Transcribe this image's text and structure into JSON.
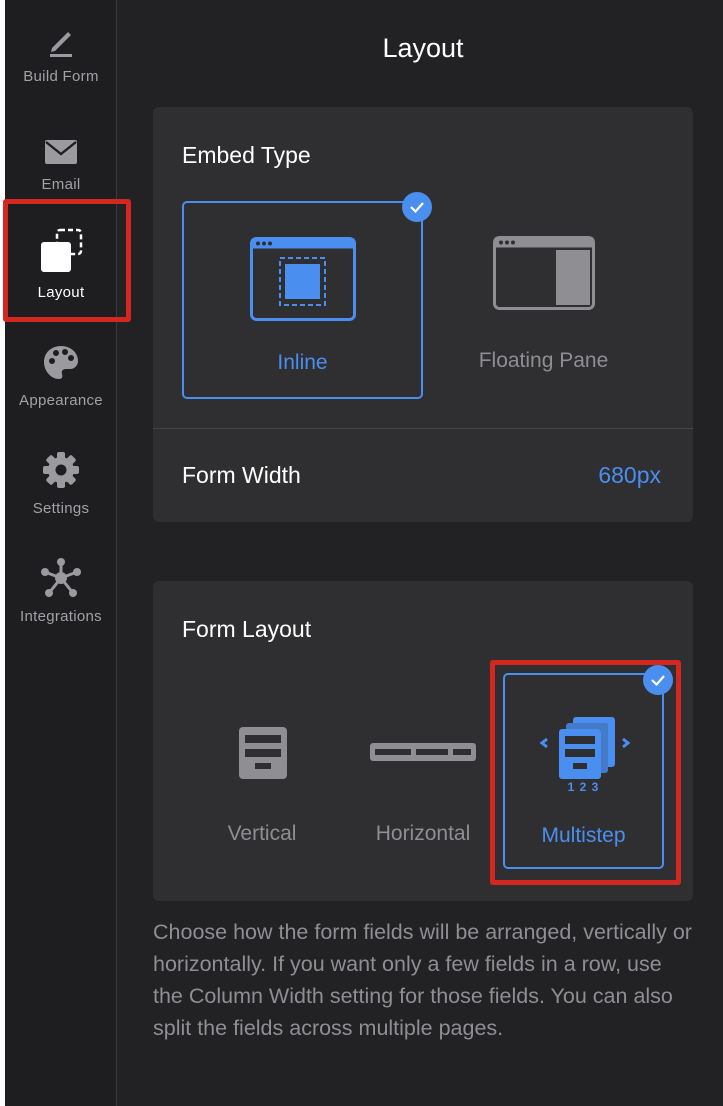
{
  "sidebar": {
    "items": [
      {
        "label": "Build Form",
        "icon": "pencil-icon"
      },
      {
        "label": "Email",
        "icon": "envelope-icon"
      },
      {
        "label": "Layout",
        "icon": "layout-icon",
        "active": true
      },
      {
        "label": "Appearance",
        "icon": "palette-icon"
      },
      {
        "label": "Settings",
        "icon": "gear-icon"
      },
      {
        "label": "Integrations",
        "icon": "integrations-icon"
      }
    ]
  },
  "page": {
    "title": "Layout"
  },
  "embed": {
    "title": "Embed Type",
    "options": [
      {
        "label": "Inline",
        "selected": true
      },
      {
        "label": "Floating Pane",
        "selected": false
      }
    ],
    "width_label": "Form Width",
    "width_value": "680px"
  },
  "form_layout": {
    "title": "Form Layout",
    "options": [
      {
        "label": "Vertical",
        "selected": false
      },
      {
        "label": "Horizontal",
        "selected": false
      },
      {
        "label": "Multistep",
        "selected": true
      }
    ],
    "step_numbers": "1 2 3"
  },
  "help_text": "Choose how the form fields will be arranged, vertically or horizontally. If you want only a few fields in a row, use the Column Width setting for those fields. You can also split the fields across multiple pages.",
  "colors": {
    "accent": "#4a8ef0",
    "highlight": "#d3271f",
    "panel": "#2f2f31",
    "background": "#222224"
  }
}
